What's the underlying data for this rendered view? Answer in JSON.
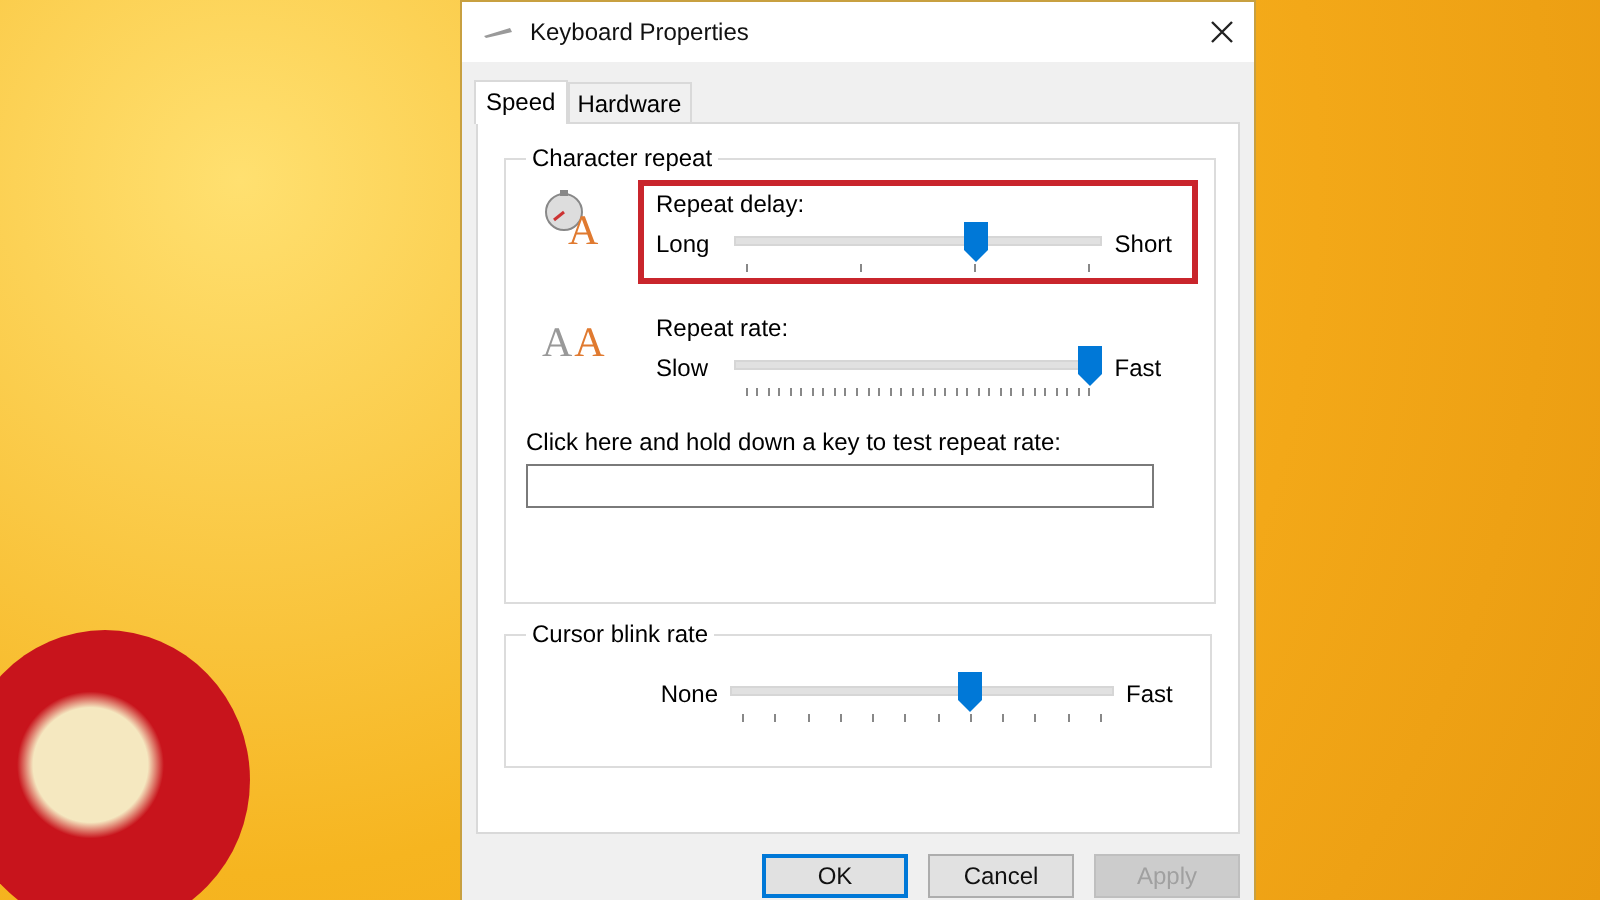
{
  "window": {
    "title": "Keyboard Properties"
  },
  "tabs": [
    {
      "label": "Speed",
      "selected": true
    },
    {
      "label": "Hardware",
      "selected": false
    }
  ],
  "character_repeat": {
    "title": "Character repeat",
    "sliders": [
      {
        "kind": "delay",
        "icon_letters": [
          "A"
        ],
        "label": "Repeat delay:",
        "min_label": "Long",
        "max_label": "Short",
        "level": 0.667,
        "highlighted": true
      },
      {
        "kind": "rate",
        "icon_letters": [
          "A",
          "A"
        ],
        "label": "Repeat rate:",
        "min_label": "Slow",
        "max_label": "Fast",
        "level": 1,
        "highlighted": false
      }
    ],
    "test_label": "Click here and hold down a key to test repeat rate:"
  },
  "cursor_blink": {
    "title": "Cursor blink rate",
    "min_label": "None",
    "max_label": "Fast",
    "level": 0.636
  },
  "buttons": [
    {
      "label": "OK",
      "default": true,
      "disabled": false
    },
    {
      "label": "Cancel",
      "default": false,
      "disabled": false
    },
    {
      "label": "Apply",
      "default": false,
      "disabled": true
    }
  ]
}
